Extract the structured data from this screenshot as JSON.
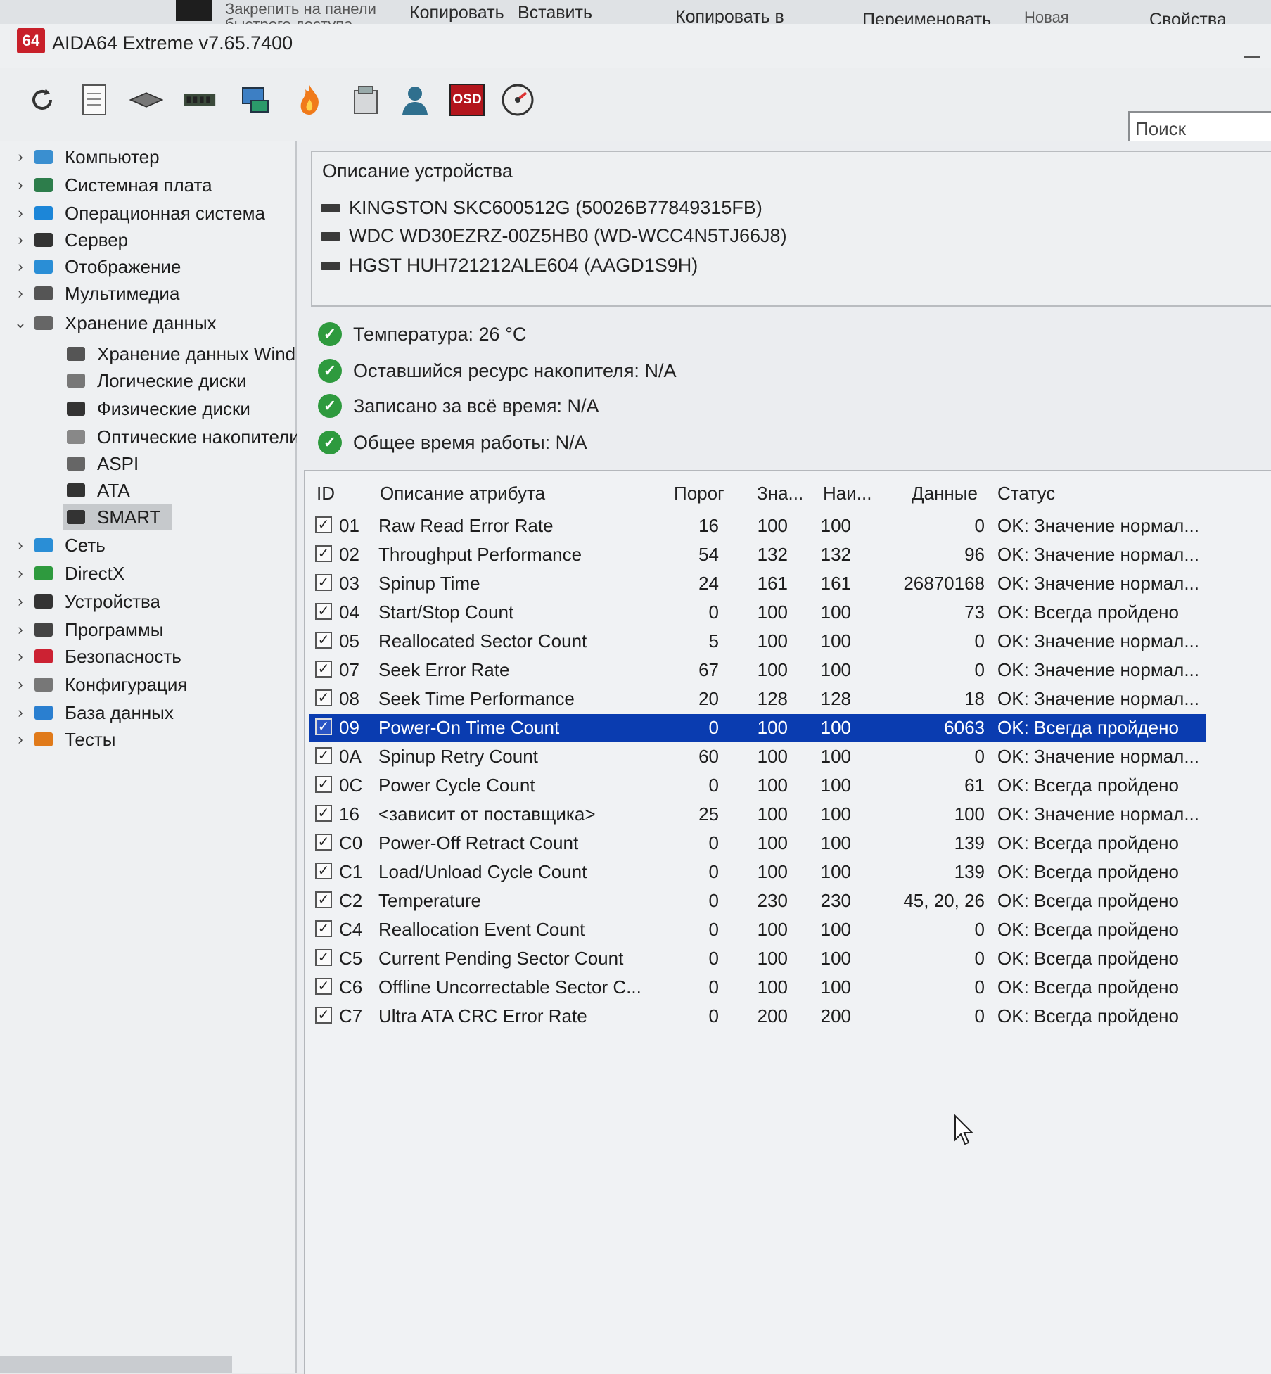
{
  "ribbon": {
    "pin_label": "Закрепить на панели быстрого доступа",
    "copy_label": "Копировать",
    "paste_label": "Вставить",
    "copy_to_label": "Копировать в",
    "rename_label": "Переименовать",
    "new_folder_label": "Новая папка",
    "properties_label": "Свойства"
  },
  "window": {
    "logo_text": "64",
    "title": "AIDA64 Extreme v7.65.7400"
  },
  "toolbar": {
    "icons": [
      "refresh-icon",
      "report-icon",
      "motherboard-icon",
      "memory-icon",
      "network-icon",
      "flame-icon",
      "disk-icon",
      "user-icon",
      "osd-icon",
      "benchmark-icon"
    ],
    "osd_label": "OSD",
    "search_placeholder": "Поиск"
  },
  "tree": {
    "items": [
      {
        "label": "Компьютер",
        "icon": "computer-icon",
        "expanded": false
      },
      {
        "label": "Системная плата",
        "icon": "motherboard-icon",
        "expanded": false
      },
      {
        "label": "Операционная система",
        "icon": "windows-icon",
        "expanded": false
      },
      {
        "label": "Сервер",
        "icon": "server-icon",
        "expanded": false
      },
      {
        "label": "Отображение",
        "icon": "display-icon",
        "expanded": false
      },
      {
        "label": "Мультимедиа",
        "icon": "speaker-icon",
        "expanded": false
      },
      {
        "label": "Хранение данных",
        "icon": "storage-icon",
        "expanded": true
      },
      {
        "label": "Хранение данных Wind",
        "icon": "storage-windows-icon",
        "child": true
      },
      {
        "label": "Логические диски",
        "icon": "logical-disk-icon",
        "child": true
      },
      {
        "label": "Физические диски",
        "icon": "physical-disk-icon",
        "child": true
      },
      {
        "label": "Оптические накопители",
        "icon": "optical-disk-icon",
        "child": true
      },
      {
        "label": "ASPI",
        "icon": "aspi-icon",
        "child": true
      },
      {
        "label": "ATA",
        "icon": "ata-icon",
        "child": true
      },
      {
        "label": "SMART",
        "icon": "smart-icon",
        "child": true,
        "selected": true
      },
      {
        "label": "Сеть",
        "icon": "network-icon",
        "expanded": false
      },
      {
        "label": "DirectX",
        "icon": "directx-icon",
        "expanded": false
      },
      {
        "label": "Устройства",
        "icon": "devices-icon",
        "expanded": false
      },
      {
        "label": "Программы",
        "icon": "programs-icon",
        "expanded": false
      },
      {
        "label": "Безопасность",
        "icon": "shield-icon",
        "expanded": false
      },
      {
        "label": "Конфигурация",
        "icon": "config-icon",
        "expanded": false
      },
      {
        "label": "База данных",
        "icon": "database-icon",
        "expanded": false
      },
      {
        "label": "Тесты",
        "icon": "tests-icon",
        "expanded": false
      }
    ]
  },
  "devices": {
    "header": "Описание устройства",
    "items": [
      "KINGSTON SKC600512G (50026B77849315FB)",
      "WDC WD30EZRZ-00Z5HB0 (WD-WCC4N5TJ66J8)",
      "HGST HUH721212ALE604 (AAGD1S9H)"
    ]
  },
  "summary": [
    "Температура: 26 °C",
    "Оставшийся ресурс накопителя: N/A",
    "Записано за всё время: N/A",
    "Общее время работы: N/A"
  ],
  "smart_table": {
    "headers": {
      "id": "ID",
      "desc": "Описание атрибута",
      "threshold": "Порог",
      "value": "Зна...",
      "worst": "Наи...",
      "data": "Данные",
      "status": "Статус"
    },
    "rows": [
      {
        "id": "01",
        "desc": "Raw Read Error Rate",
        "threshold": "16",
        "value": "100",
        "worst": "100",
        "data": "0",
        "status": "OK: Значение нормал..."
      },
      {
        "id": "02",
        "desc": "Throughput Performance",
        "threshold": "54",
        "value": "132",
        "worst": "132",
        "data": "96",
        "status": "OK: Значение нормал..."
      },
      {
        "id": "03",
        "desc": "Spinup Time",
        "threshold": "24",
        "value": "161",
        "worst": "161",
        "data": "26870168",
        "status": "OK: Значение нормал..."
      },
      {
        "id": "04",
        "desc": "Start/Stop Count",
        "threshold": "0",
        "value": "100",
        "worst": "100",
        "data": "73",
        "status": "OK: Всегда пройдено"
      },
      {
        "id": "05",
        "desc": "Reallocated Sector Count",
        "threshold": "5",
        "value": "100",
        "worst": "100",
        "data": "0",
        "status": "OK: Значение нормал..."
      },
      {
        "id": "07",
        "desc": "Seek Error Rate",
        "threshold": "67",
        "value": "100",
        "worst": "100",
        "data": "0",
        "status": "OK: Значение нормал..."
      },
      {
        "id": "08",
        "desc": "Seek Time Performance",
        "threshold": "20",
        "value": "128",
        "worst": "128",
        "data": "18",
        "status": "OK: Значение нормал..."
      },
      {
        "id": "09",
        "desc": "Power-On Time Count",
        "threshold": "0",
        "value": "100",
        "worst": "100",
        "data": "6063",
        "status": "OK: Всегда пройдено",
        "selected": true
      },
      {
        "id": "0A",
        "desc": "Spinup Retry Count",
        "threshold": "60",
        "value": "100",
        "worst": "100",
        "data": "0",
        "status": "OK: Значение нормал..."
      },
      {
        "id": "0C",
        "desc": "Power Cycle Count",
        "threshold": "0",
        "value": "100",
        "worst": "100",
        "data": "61",
        "status": "OK: Всегда пройдено"
      },
      {
        "id": "16",
        "desc": "<зависит от поставщика>",
        "threshold": "25",
        "value": "100",
        "worst": "100",
        "data": "100",
        "status": "OK: Значение нормал..."
      },
      {
        "id": "C0",
        "desc": "Power-Off Retract Count",
        "threshold": "0",
        "value": "100",
        "worst": "100",
        "data": "139",
        "status": "OK: Всегда пройдено"
      },
      {
        "id": "C1",
        "desc": "Load/Unload Cycle Count",
        "threshold": "0",
        "value": "100",
        "worst": "100",
        "data": "139",
        "status": "OK: Всегда пройдено"
      },
      {
        "id": "C2",
        "desc": "Temperature",
        "threshold": "0",
        "value": "230",
        "worst": "230",
        "data": "45, 20, 26",
        "status": "OK: Всегда пройдено"
      },
      {
        "id": "C4",
        "desc": "Reallocation Event Count",
        "threshold": "0",
        "value": "100",
        "worst": "100",
        "data": "0",
        "status": "OK: Всегда пройдено"
      },
      {
        "id": "C5",
        "desc": "Current Pending Sector Count",
        "threshold": "0",
        "value": "100",
        "worst": "100",
        "data": "0",
        "status": "OK: Всегда пройдено"
      },
      {
        "id": "C6",
        "desc": "Offline Uncorrectable Sector C...",
        "threshold": "0",
        "value": "100",
        "worst": "100",
        "data": "0",
        "status": "OK: Всегда пройдено"
      },
      {
        "id": "C7",
        "desc": "Ultra ATA CRC Error Rate",
        "threshold": "0",
        "value": "200",
        "worst": "200",
        "data": "0",
        "status": "OK: Всегда пройдено"
      }
    ]
  },
  "colors": {
    "selection": "#0a3cb0",
    "ok_green": "#2e9a3e",
    "logo_red": "#c8202a"
  }
}
